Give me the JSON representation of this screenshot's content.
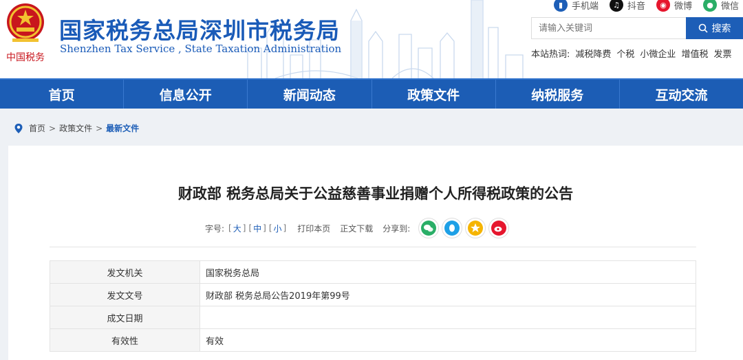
{
  "header": {
    "title_cn": "国家税务总局深圳市税务局",
    "title_en": "Shenzhen Tax Service , State Taxation Administration",
    "emblem_text": "中国税务"
  },
  "toplinks": [
    {
      "label": "手机端",
      "icon": "phone-icon",
      "color": "#1d5eb7"
    },
    {
      "label": "抖音",
      "icon": "douyin-icon",
      "color": "#111111"
    },
    {
      "label": "微博",
      "icon": "weibo-icon",
      "color": "#e6162d"
    },
    {
      "label": "微信",
      "icon": "wechat-icon",
      "color": "#2aae67"
    }
  ],
  "search": {
    "placeholder": "请输入关键词",
    "button_label": "搜索"
  },
  "hotwords": {
    "label": "本站热词:",
    "items": [
      "减税降费",
      "个税",
      "小微企业",
      "增值税",
      "发票"
    ]
  },
  "nav": [
    "首页",
    "信息公开",
    "新闻动态",
    "政策文件",
    "纳税服务",
    "互动交流"
  ],
  "breadcrumb": {
    "items": [
      "首页",
      "政策文件"
    ],
    "current": "最新文件",
    "separator": ">"
  },
  "article": {
    "title": "财政部 税务总局关于公益慈善事业捐赠个人所得税政策的公告",
    "tools": {
      "font_label": "字号:",
      "sizes": [
        "大",
        "中",
        "小"
      ],
      "print": "打印本页",
      "download": "正文下载",
      "share_label": "分享到:"
    },
    "share": [
      {
        "icon": "wechat-share-icon",
        "color": "#2aae67"
      },
      {
        "icon": "qq-share-icon",
        "color": "#1ea0e6"
      },
      {
        "icon": "qzone-share-icon",
        "color": "#f5b400"
      },
      {
        "icon": "weibo-share-icon",
        "color": "#e6162d"
      }
    ],
    "meta": [
      {
        "key": "发文机关",
        "value": "国家税务总局"
      },
      {
        "key": "发文文号",
        "value": "财政部 税务总局公告2019年第99号"
      },
      {
        "key": "成文日期",
        "value": ""
      },
      {
        "key": "有效性",
        "value": "有效"
      }
    ]
  },
  "colors": {
    "brand_blue": "#1a5bb8",
    "nav_blue": "#1c5db5",
    "page_bg": "#eef1f5"
  }
}
